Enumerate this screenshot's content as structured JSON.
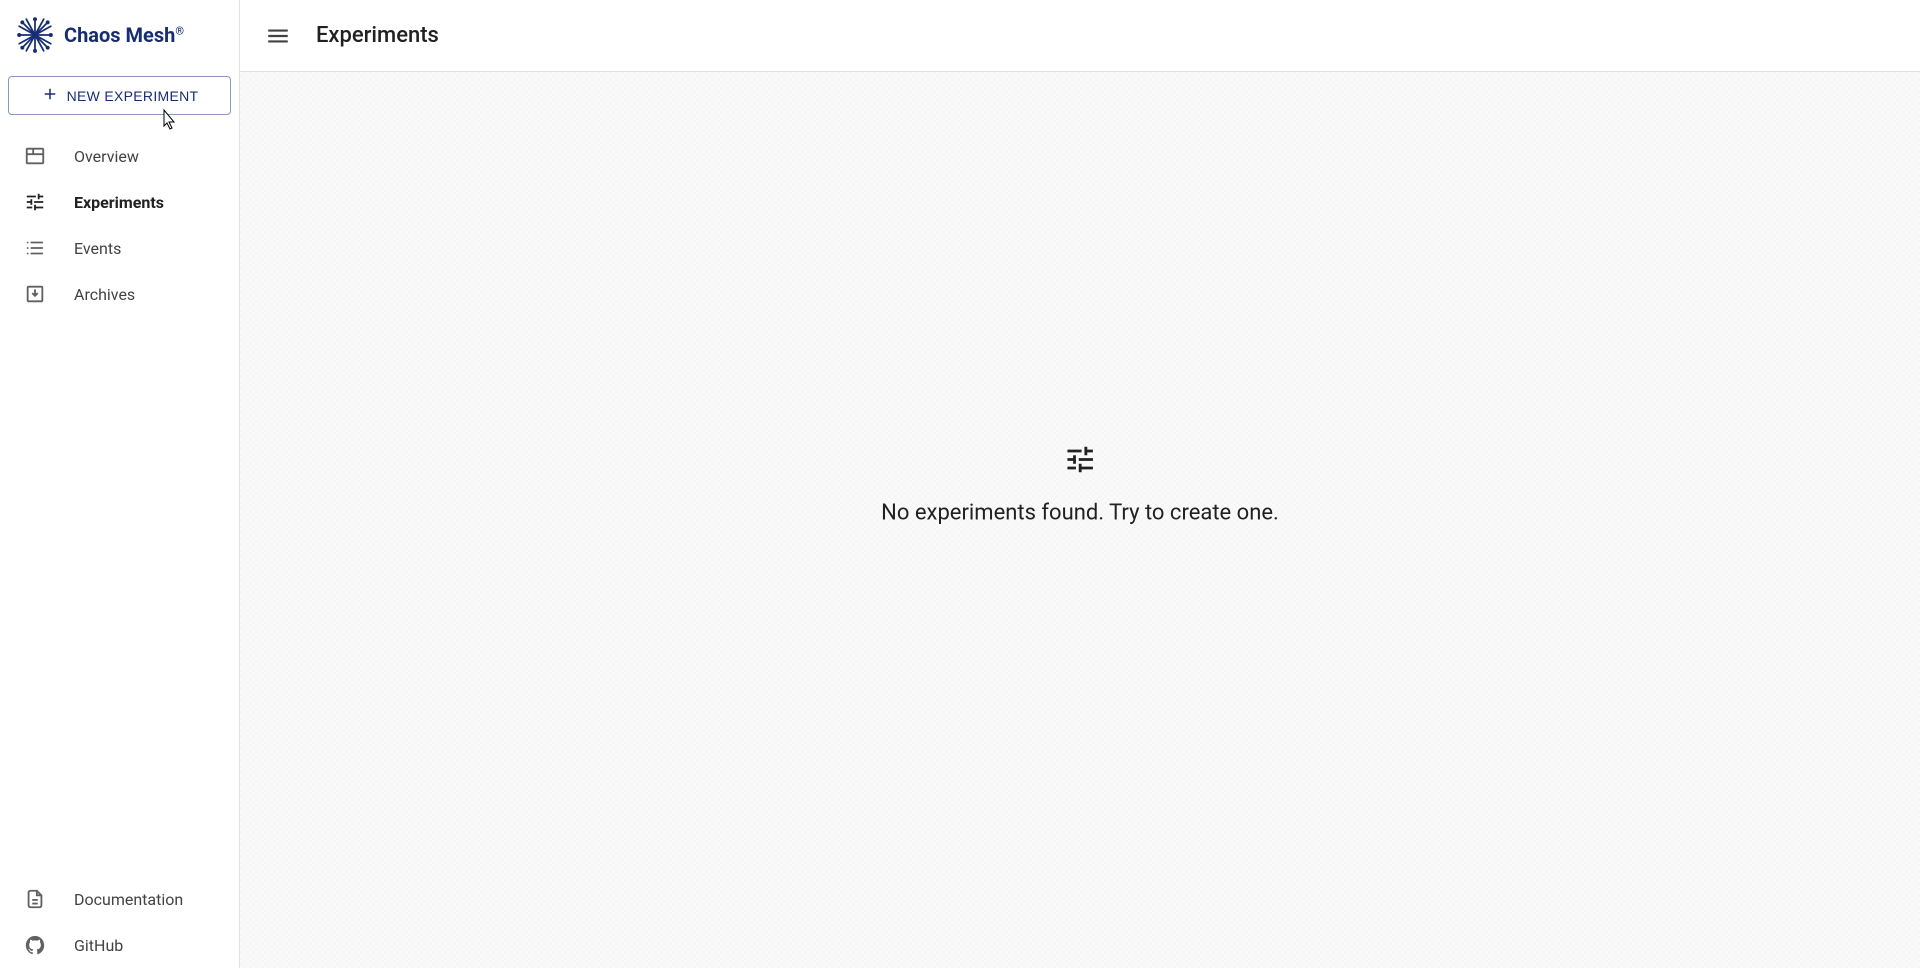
{
  "brand": {
    "name": "Chaos Mesh",
    "registered": "®"
  },
  "sidebar": {
    "new_experiment_label": "NEW EXPERIMENT",
    "items": [
      {
        "label": "Overview",
        "icon": "dashboard"
      },
      {
        "label": "Experiments",
        "icon": "tune",
        "active": true
      },
      {
        "label": "Events",
        "icon": "events"
      },
      {
        "label": "Archives",
        "icon": "archive"
      }
    ],
    "footer": [
      {
        "label": "Documentation",
        "icon": "doc"
      },
      {
        "label": "GitHub",
        "icon": "github"
      }
    ]
  },
  "header": {
    "title": "Experiments"
  },
  "empty_state": {
    "message": "No experiments found. Try to create one."
  }
}
